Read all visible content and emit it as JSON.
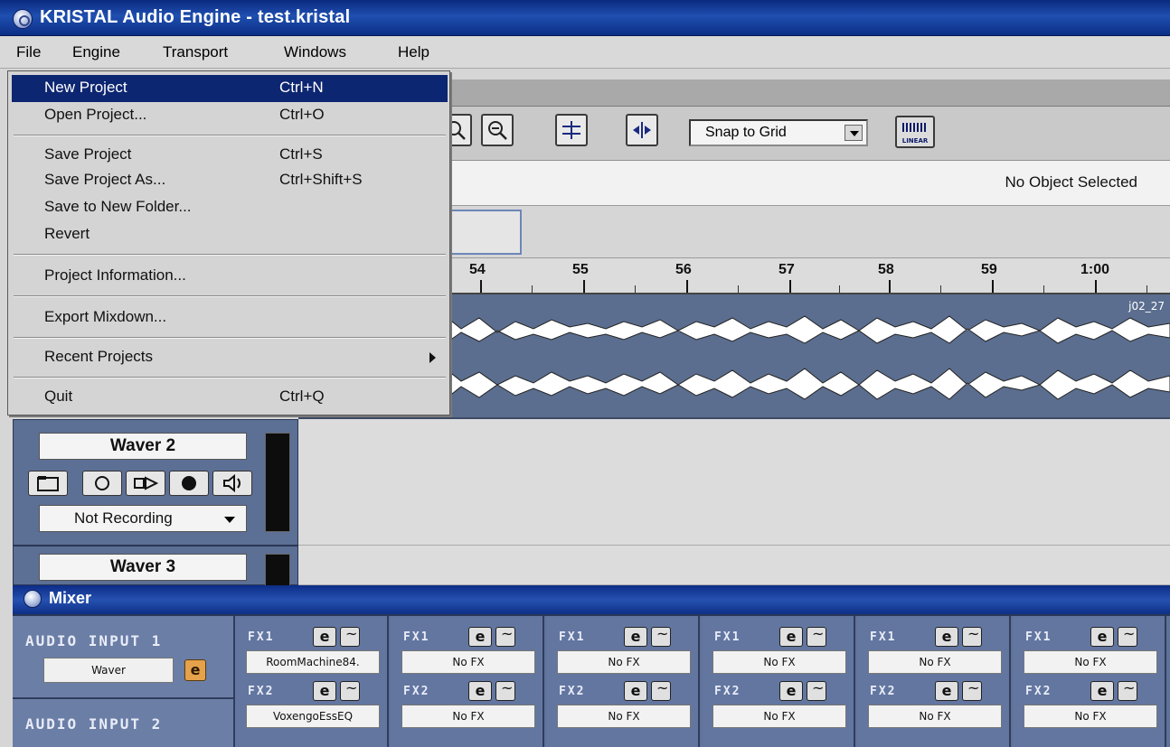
{
  "window": {
    "title": "KRISTAL Audio Engine - test.kristal"
  },
  "menubar": {
    "items": [
      {
        "label": "File"
      },
      {
        "label": "Engine"
      },
      {
        "label": "Transport"
      },
      {
        "label": "Windows"
      },
      {
        "label": "Help"
      }
    ]
  },
  "file_menu": {
    "items": [
      {
        "label": "New Project",
        "shortcut": "Ctrl+N",
        "highlighted": true
      },
      {
        "label": "Open Project...",
        "shortcut": "Ctrl+O"
      },
      {
        "label": "Save Project",
        "shortcut": "Ctrl+S"
      },
      {
        "label": "Save Project As...",
        "shortcut": "Ctrl+Shift+S"
      },
      {
        "label": "Save to New Folder...",
        "shortcut": ""
      },
      {
        "label": "Revert",
        "shortcut": ""
      },
      {
        "label": "Project Information...",
        "shortcut": ""
      },
      {
        "label": "Export Mixdown...",
        "shortcut": ""
      },
      {
        "label": "Recent Projects",
        "shortcut": "",
        "submenu": true
      },
      {
        "label": "Quit",
        "shortcut": "Ctrl+Q"
      }
    ]
  },
  "toolbar": {
    "snap_label": "Snap to Grid",
    "linear_label": "LINEAR",
    "icons": [
      "zoom-in-icon",
      "zoom-out-icon",
      "split-icon",
      "merge-icon",
      "linear-icon"
    ]
  },
  "info": {
    "status": "No Object Selected"
  },
  "ruler": {
    "labels": [
      "54",
      "55",
      "56",
      "57",
      "58",
      "59",
      "1:00"
    ]
  },
  "clip": {
    "name": "j02_27"
  },
  "tracks": [
    {
      "name": "Waver 2",
      "record_mode": "Not Recording"
    },
    {
      "name": "Waver 3"
    }
  ],
  "mixer": {
    "title": "Mixer",
    "inputs": [
      {
        "label": "AUDIO INPUT 1",
        "source": "Waver",
        "edit": "e"
      },
      {
        "label": "AUDIO INPUT 2"
      }
    ],
    "fx_strips": [
      {
        "fx1_label": "FX1",
        "fx1": "RoomMachine84.",
        "fx2_label": "FX2",
        "fx2": "VoxengoEssEQ",
        "edit": "e"
      },
      {
        "fx1_label": "FX1",
        "fx1": "No FX",
        "fx2_label": "FX2",
        "fx2": "No FX",
        "edit": "e"
      },
      {
        "fx1_label": "FX1",
        "fx1": "No FX",
        "fx2_label": "FX2",
        "fx2": "No FX",
        "edit": "e"
      },
      {
        "fx1_label": "FX1",
        "fx1": "No FX",
        "fx2_label": "FX2",
        "fx2": "No FX",
        "edit": "e"
      },
      {
        "fx1_label": "FX1",
        "fx1": "No FX",
        "fx2_label": "FX2",
        "fx2": "No FX",
        "edit": "e"
      },
      {
        "fx1_label": "FX1",
        "fx1": "No FX",
        "fx2_label": "FX2",
        "fx2": "No FX",
        "edit": "e"
      }
    ]
  },
  "colors": {
    "titlebar": "#1f4fb0",
    "menu_highlight": "#0d2671",
    "track_panel": "#5c6f95",
    "wave_bg": "#5b6e8f",
    "edit_button": "#e6a24b"
  }
}
